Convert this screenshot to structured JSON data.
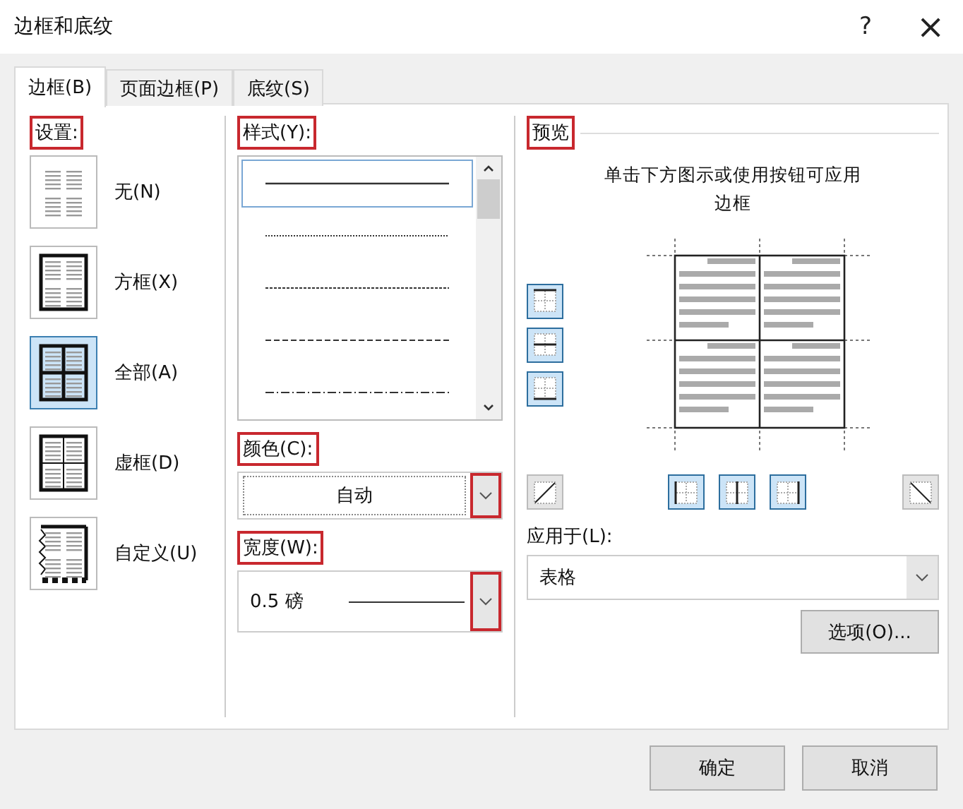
{
  "window": {
    "title": "边框和底纹",
    "help": "?",
    "close": "×"
  },
  "tabs": [
    {
      "label": "边框(B)",
      "selected": true
    },
    {
      "label": "页面边框(P)",
      "selected": false
    },
    {
      "label": "底纹(S)",
      "selected": false
    }
  ],
  "setting": {
    "label": "设置:",
    "annotated": true,
    "items": [
      {
        "label": "无(N)",
        "kind": "none",
        "selected": false
      },
      {
        "label": "方框(X)",
        "kind": "box",
        "selected": false
      },
      {
        "label": "全部(A)",
        "kind": "all",
        "selected": true
      },
      {
        "label": "虚框(D)",
        "kind": "grid",
        "selected": false
      },
      {
        "label": "自定义(U)",
        "kind": "custom",
        "selected": false
      }
    ]
  },
  "style": {
    "label": "样式(Y):",
    "annotated": true,
    "items": [
      {
        "kind": "solid",
        "selected": true
      },
      {
        "kind": "dotted",
        "selected": false
      },
      {
        "kind": "fine-dash",
        "selected": false
      },
      {
        "kind": "dashed",
        "selected": false
      },
      {
        "kind": "dash-dot",
        "selected": false
      }
    ]
  },
  "color": {
    "label": "颜色(C):",
    "annotated": true,
    "value": "自动",
    "arrow_annotated": true
  },
  "width": {
    "label": "宽度(W):",
    "annotated": true,
    "value": "0.5 磅",
    "arrow_annotated": true
  },
  "preview": {
    "label": "预览",
    "annotated": true,
    "hint": "单击下方图示或使用按钮可应用边框",
    "side_buttons": [
      {
        "kind": "top",
        "on": true
      },
      {
        "kind": "middle",
        "on": true
      },
      {
        "kind": "bottom",
        "on": true
      }
    ],
    "bottom_buttons": [
      {
        "kind": "diag-up",
        "on": false
      },
      {
        "kind": "left",
        "on": true
      },
      {
        "kind": "center",
        "on": true
      },
      {
        "kind": "right",
        "on": true
      },
      {
        "kind": "diag-down",
        "on": false
      }
    ]
  },
  "apply_to": {
    "label": "应用于(L):",
    "value": "表格"
  },
  "options_button": "选项(O)...",
  "buttons": [
    "确定",
    "取消"
  ]
}
